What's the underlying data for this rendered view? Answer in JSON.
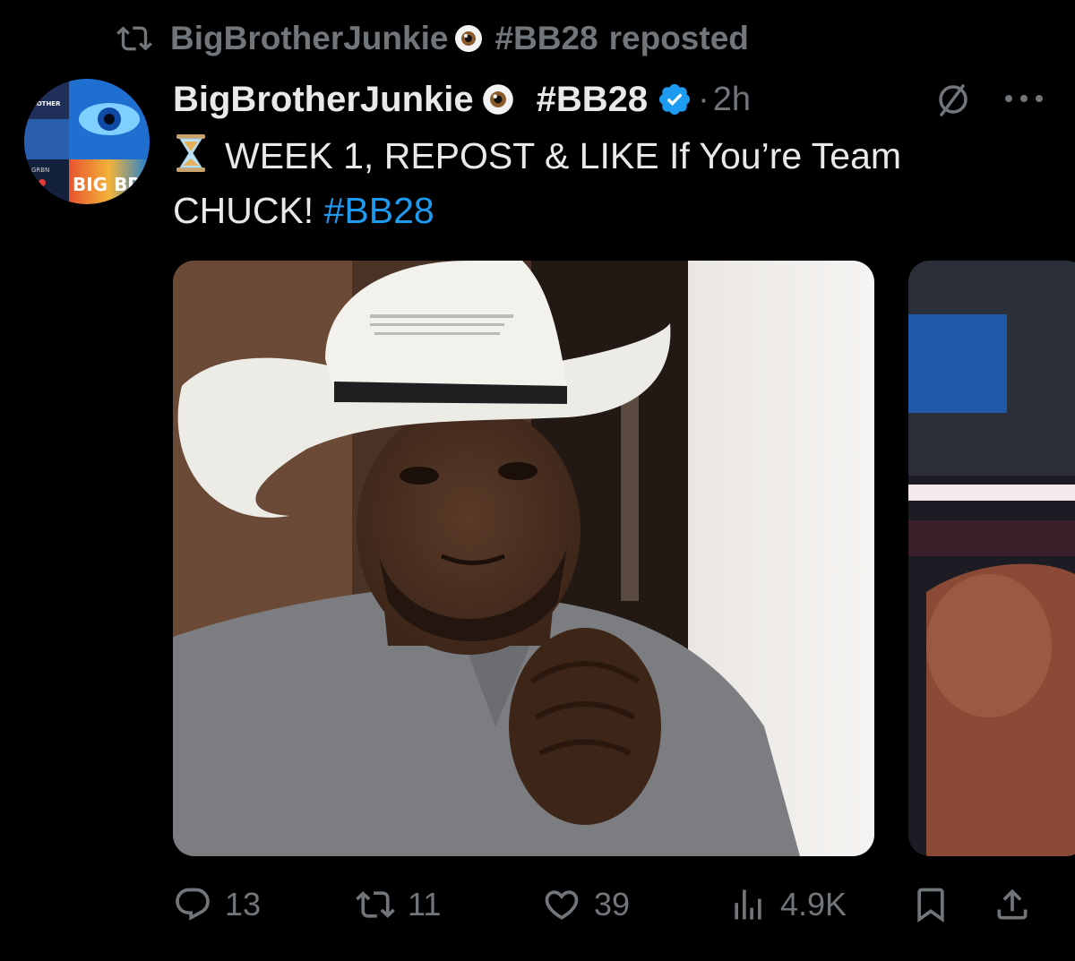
{
  "repost_banner": {
    "account": "BigBrotherJunkie",
    "hashtag": "#BB28",
    "suffix": "reposted",
    "icon": "repost-icon"
  },
  "post": {
    "author_name": "BigBrotherJunkie",
    "author_hashtag": "#BB28",
    "verified_icon": "verified-badge-icon",
    "separator": "·",
    "timestamp": "2h",
    "text_line1": "WEEK 1, REPOST & LIKE If You’re Team",
    "text_line2": "CHUCK!",
    "text_hashtag": "#BB28",
    "emoji": "hourglass-icon",
    "avatar_text": "BIG BROTH",
    "avatar_label_small": "BROTHER",
    "avatar_label_small2": "GRBN"
  },
  "actions": {
    "replies": "13",
    "reposts": "11",
    "likes": "39",
    "views": "4.9K"
  },
  "colors": {
    "background": "#000000",
    "text": "#e7e9ea",
    "muted": "#71767b",
    "link": "#1d9bf0",
    "verified": "#1d9bf0"
  }
}
